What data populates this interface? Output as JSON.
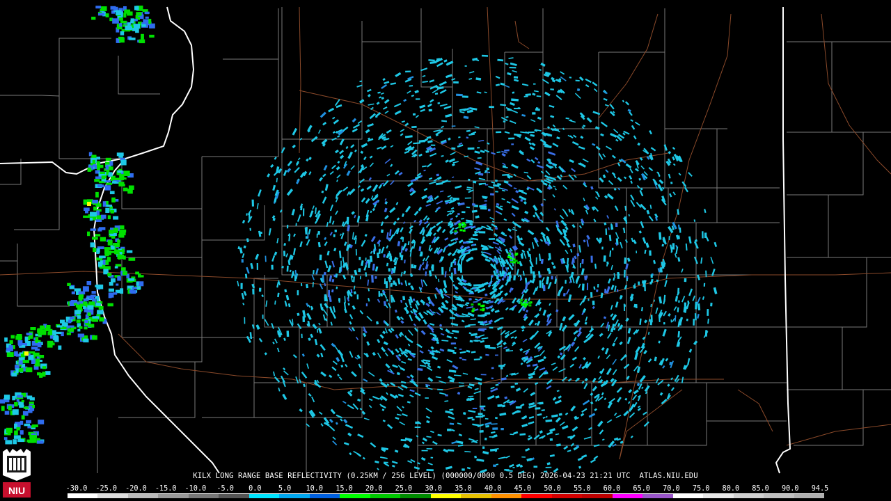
{
  "caption": "KILX LONG RANGE BASE REFLECTIVITY (0.25KM / 256 LEVEL) (000000/0000 0.5 DEG) 2026-04-23 21:21 UTC  ATLAS.NIU.EDU",
  "logo": {
    "text": "NIU",
    "icon": "niu-logo-icon"
  },
  "colors": {
    "background": "#000000",
    "county_lines": "#7a7a7a",
    "state_lines": "#ffffff",
    "highways": "#8b4a2a",
    "logo_red": "#c8102e"
  },
  "scale": {
    "labels": [
      "-30.0",
      "-25.0",
      "-20.0",
      "-15.0",
      "-10.0",
      "-5.0",
      "0.0",
      "5.0",
      "10.0",
      "15.0",
      "20.0",
      "25.0",
      "30.0",
      "35.0",
      "40.0",
      "45.0",
      "50.0",
      "55.0",
      "60.0",
      "65.0",
      "70.0",
      "75.0",
      "80.0",
      "85.0",
      "90.0",
      "94.5"
    ],
    "colors": [
      "#ffffff",
      "#dddddd",
      "#bbbbbb",
      "#999999",
      "#777777",
      "#555555",
      "#00e4ff",
      "#00a8f0",
      "#0060e0",
      "#00ff00",
      "#00c800",
      "#008c00",
      "#ffff00",
      "#e6c000",
      "#ff9000",
      "#ff0000",
      "#d40000",
      "#be0000",
      "#ff00ff",
      "#9955c9",
      "#ffffff",
      "#e8e8e8",
      "#d0d0d0",
      "#c0c0c0",
      "#b0b0b0"
    ]
  }
}
